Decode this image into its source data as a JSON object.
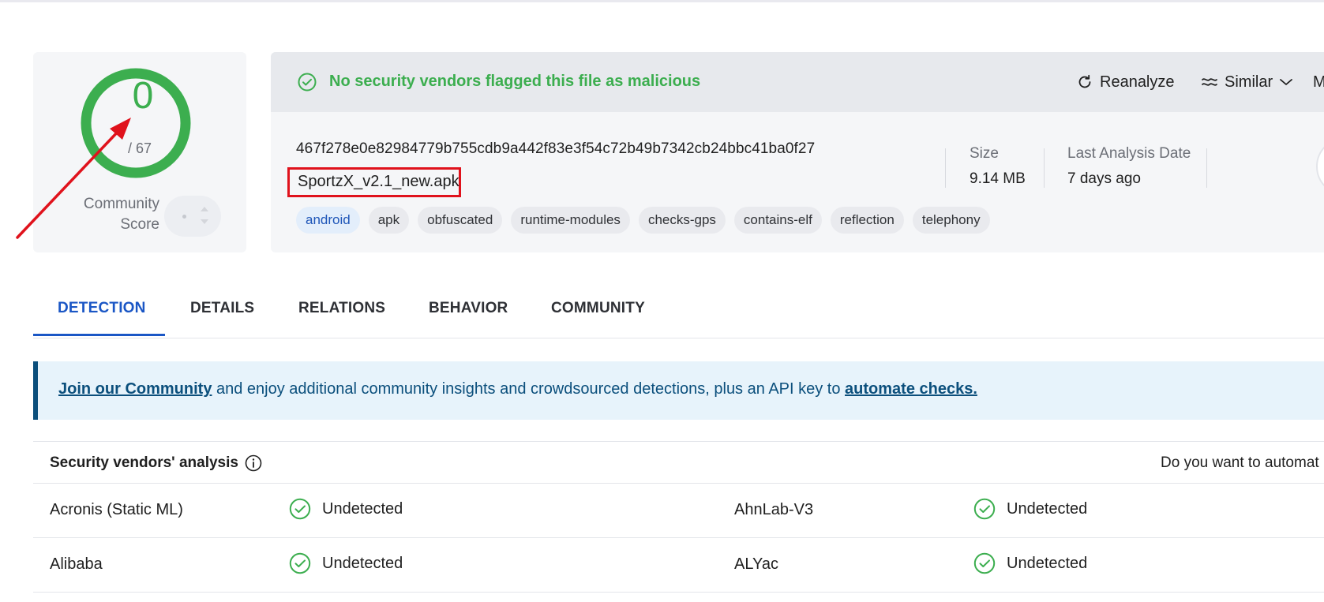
{
  "community_score": {
    "detections": "0",
    "total": "/ 67",
    "label_line1": "Community",
    "label_line2": "Score"
  },
  "banner": {
    "status": "No security vendors flagged this file as malicious",
    "reanalyze_label": "Reanalyze",
    "similar_label": "Similar",
    "more_label": "M"
  },
  "file": {
    "hash": "467f278e0e82984779b755cdb9a442f83e3f54c72b49b7342cb24bbc41ba0f27",
    "name": "SportzX_v2.1_new.apk",
    "tags": [
      "android",
      "apk",
      "obfuscated",
      "runtime-modules",
      "checks-gps",
      "contains-elf",
      "reflection",
      "telephony"
    ],
    "size_label": "Size",
    "size_value": "9.14 MB",
    "last_analysis_label": "Last Analysis Date",
    "last_analysis_value": "7 days ago"
  },
  "tabs": [
    "DETECTION",
    "DETAILS",
    "RELATIONS",
    "BEHAVIOR",
    "COMMUNITY"
  ],
  "join_banner": {
    "link1": "Join our Community",
    "middle": " and enjoy additional community insights and crowdsourced detections, plus an API key to ",
    "link2": "automate checks."
  },
  "vendors": {
    "title": "Security vendors' analysis",
    "right_text": "Do you want to automat",
    "rows": [
      {
        "left_name": "Acronis (Static ML)",
        "left_result": "Undetected",
        "right_name": "AhnLab-V3",
        "right_result": "Undetected"
      },
      {
        "left_name": "Alibaba",
        "left_result": "Undetected",
        "right_name": "ALYac",
        "right_result": "Undetected"
      }
    ]
  },
  "colors": {
    "clean_green": "#3cae4f",
    "accent_blue": "#1a56c5",
    "highlight_red": "#e0121c"
  }
}
